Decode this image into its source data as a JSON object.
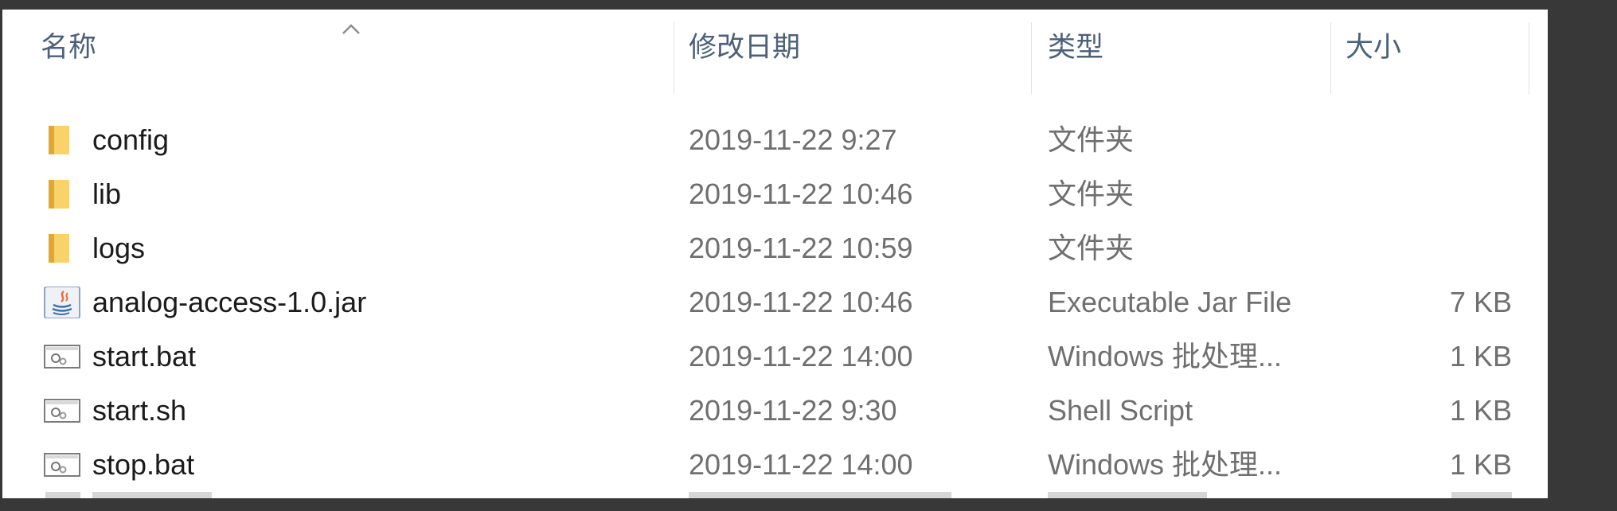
{
  "header": {
    "name": "名称",
    "modified": "修改日期",
    "type": "类型",
    "size": "大小"
  },
  "files": [
    {
      "name": "config",
      "modified": "2019-11-22 9:27",
      "type": "文件夹",
      "size": "",
      "icon": "folder-icon"
    },
    {
      "name": "lib",
      "modified": "2019-11-22 10:46",
      "type": "文件夹",
      "size": "",
      "icon": "folder-icon"
    },
    {
      "name": "logs",
      "modified": "2019-11-22 10:59",
      "type": "文件夹",
      "size": "",
      "icon": "folder-icon"
    },
    {
      "name": "analog-access-1.0.jar",
      "modified": "2019-11-22 10:46",
      "type": "Executable Jar File",
      "size": "7 KB",
      "icon": "java-jar-icon"
    },
    {
      "name": "start.bat",
      "modified": "2019-11-22 14:00",
      "type": "Windows 批处理...",
      "size": "1 KB",
      "icon": "script-file-icon"
    },
    {
      "name": "start.sh",
      "modified": "2019-11-22 9:30",
      "type": "Shell Script",
      "size": "1 KB",
      "icon": "script-file-icon"
    },
    {
      "name": "stop.bat",
      "modified": "2019-11-22 14:00",
      "type": "Windows 批处理...",
      "size": "1 KB",
      "icon": "script-file-icon"
    }
  ],
  "colors": {
    "header_text": "#4c607a",
    "name_text": "#1b1b1b",
    "detail_text": "#6f6f6f",
    "folder": "#f5c342"
  }
}
